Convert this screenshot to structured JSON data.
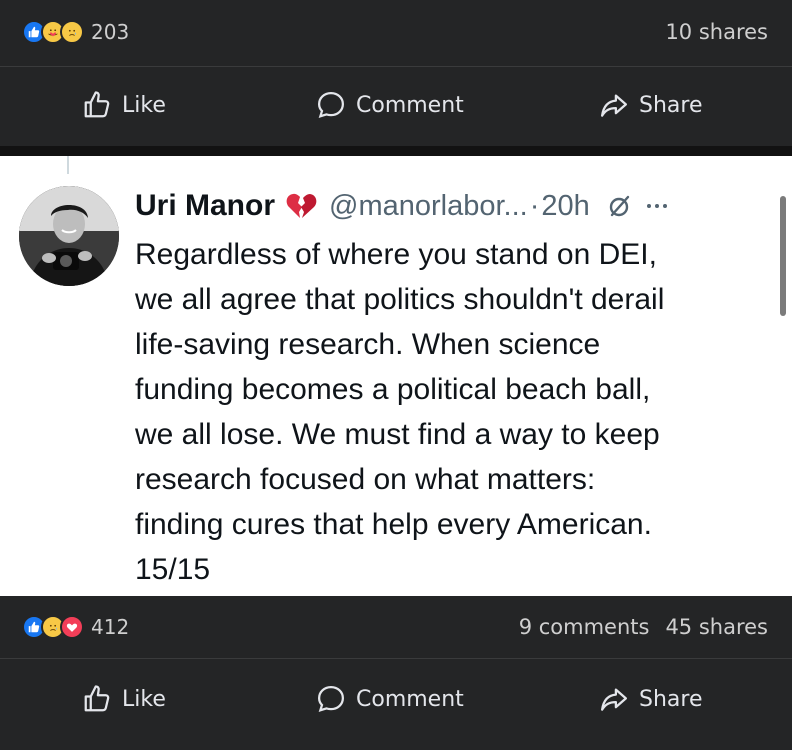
{
  "top_post": {
    "reactions": [
      "like",
      "love-hug",
      "sad"
    ],
    "reaction_count": "203",
    "shares": "10 shares",
    "actions": {
      "like": "Like",
      "comment": "Comment",
      "share": "Share"
    }
  },
  "tweet": {
    "author_name": "Uri Manor",
    "name_emoji": "broken-heart-icon",
    "handle": "@manorlabor...",
    "separator": "·",
    "time": "20h",
    "lines": [
      "Regardless of where you stand on DEI,",
      "we all agree that politics shouldn't derail",
      "life-saving research. When science",
      "funding becomes a political beach ball,",
      "we all lose. We must find a way to keep",
      "research focused on what matters:",
      "finding cures that help every American.",
      "15/15"
    ]
  },
  "bottom_post": {
    "reactions": [
      "like",
      "sad",
      "love"
    ],
    "reaction_count": "412",
    "comments": "9 comments",
    "shares": "45 shares",
    "actions": {
      "like": "Like",
      "comment": "Comment",
      "share": "Share"
    }
  },
  "colors": {
    "facebook_bg": "#242526",
    "like_blue": "#1877f2",
    "love_red": "#f33e58",
    "tweet_text": "#0f1419",
    "tweet_secondary": "#536471"
  }
}
